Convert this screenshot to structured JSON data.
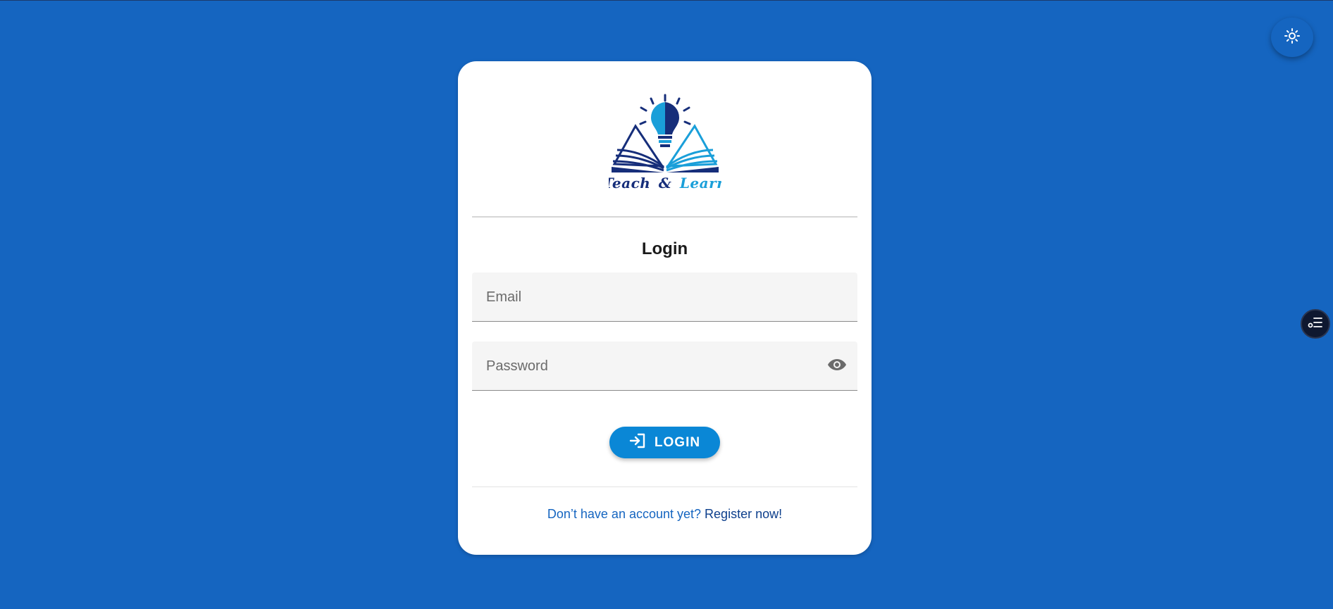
{
  "brand": {
    "word1": "Teach",
    "ampersand": "&",
    "word2": "Learn",
    "colors": {
      "dark": "#162e7a",
      "light": "#1a9fd9"
    }
  },
  "login_form": {
    "title": "Login",
    "email": {
      "placeholder": "Email",
      "value": ""
    },
    "password": {
      "placeholder": "Password",
      "value": ""
    },
    "submit_label": "LOGIN"
  },
  "footer": {
    "prompt": "Don’t have an account yet?",
    "register_link": "Register now!"
  },
  "icons": {
    "theme_toggle": "brightness-icon",
    "password_visibility": "eye-icon",
    "login": "login-icon",
    "side_widget": "checklist-icon"
  },
  "colors": {
    "background": "#1565c0",
    "card": "#ffffff",
    "button": "#0a87d6",
    "link": "#0d3f8c"
  }
}
